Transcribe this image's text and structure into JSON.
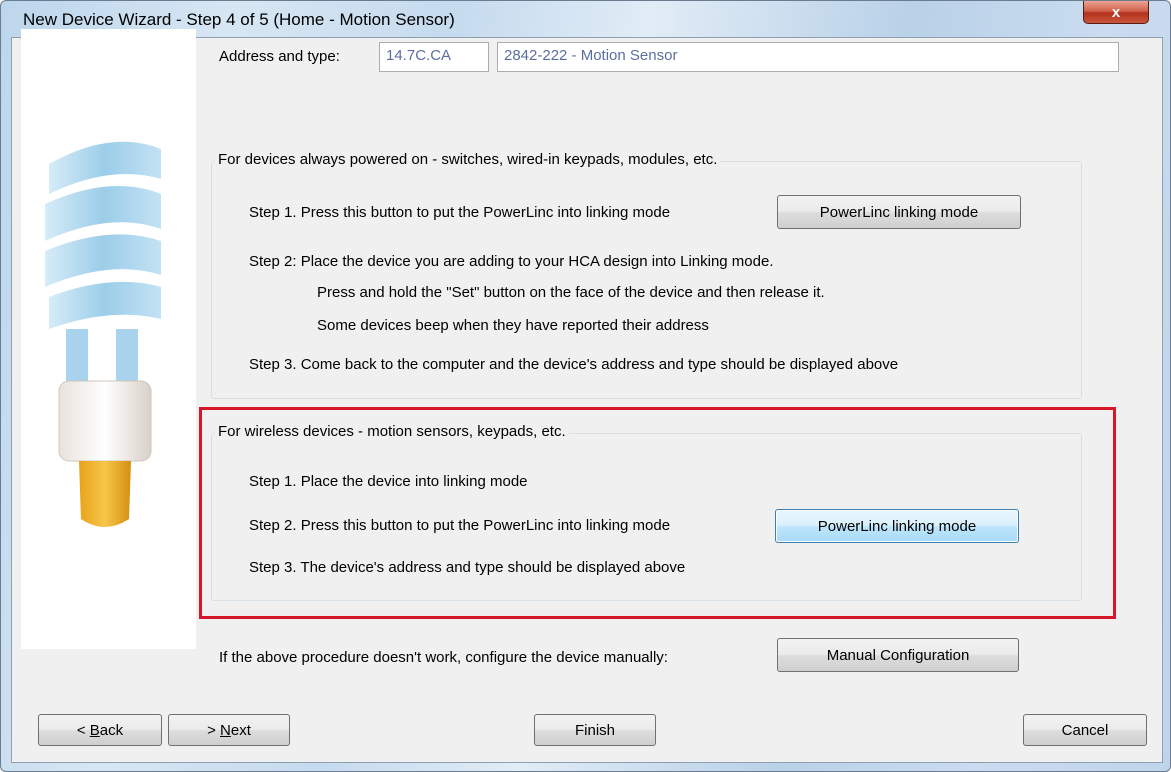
{
  "window": {
    "title": "New Device Wizard - Step 4 of 5 (Home - Motion Sensor)",
    "close_glyph": "x"
  },
  "address": {
    "label": "Address and type:",
    "address_value": "14.7C.CA",
    "type_value": "2842-222 - Motion Sensor"
  },
  "powered": {
    "legend": "For devices always powered on - switches, wired-in keypads, modules, etc.",
    "step1": "Step 1. Press this button to put the PowerLinc into linking mode",
    "step1_button": "PowerLinc linking mode",
    "step2": "Step 2:  Place the device you are adding to your HCA design into Linking mode.",
    "step2_line2": "Press and hold the \"Set\" button on the face of the device and then release it.",
    "step2_line3": "Some devices beep when they have reported their address",
    "step3": "Step 3. Come back to the computer and the device's address and type should be displayed above"
  },
  "wireless": {
    "legend": "For wireless devices - motion sensors, keypads, etc.",
    "step1": "Step 1. Place the device into linking mode",
    "step2": "Step 2. Press this button to put the PowerLinc into linking mode",
    "step2_button": "PowerLinc linking mode",
    "step3": "Step 3. The device's address and type should be displayed above"
  },
  "manual": {
    "text": "If the above procedure doesn't work, configure the device manually:",
    "button": "Manual Configuration"
  },
  "nav": {
    "back_prefix": "< ",
    "back_accel": "B",
    "back_rest": "ack",
    "next_prefix": "> ",
    "next_accel": "N",
    "next_rest": "ext",
    "finish": "Finish",
    "cancel": "Cancel"
  },
  "colors": {
    "highlight_border": "#d6172a",
    "focused_button": "#a7d9f5",
    "address_text": "#5a6fa0"
  }
}
